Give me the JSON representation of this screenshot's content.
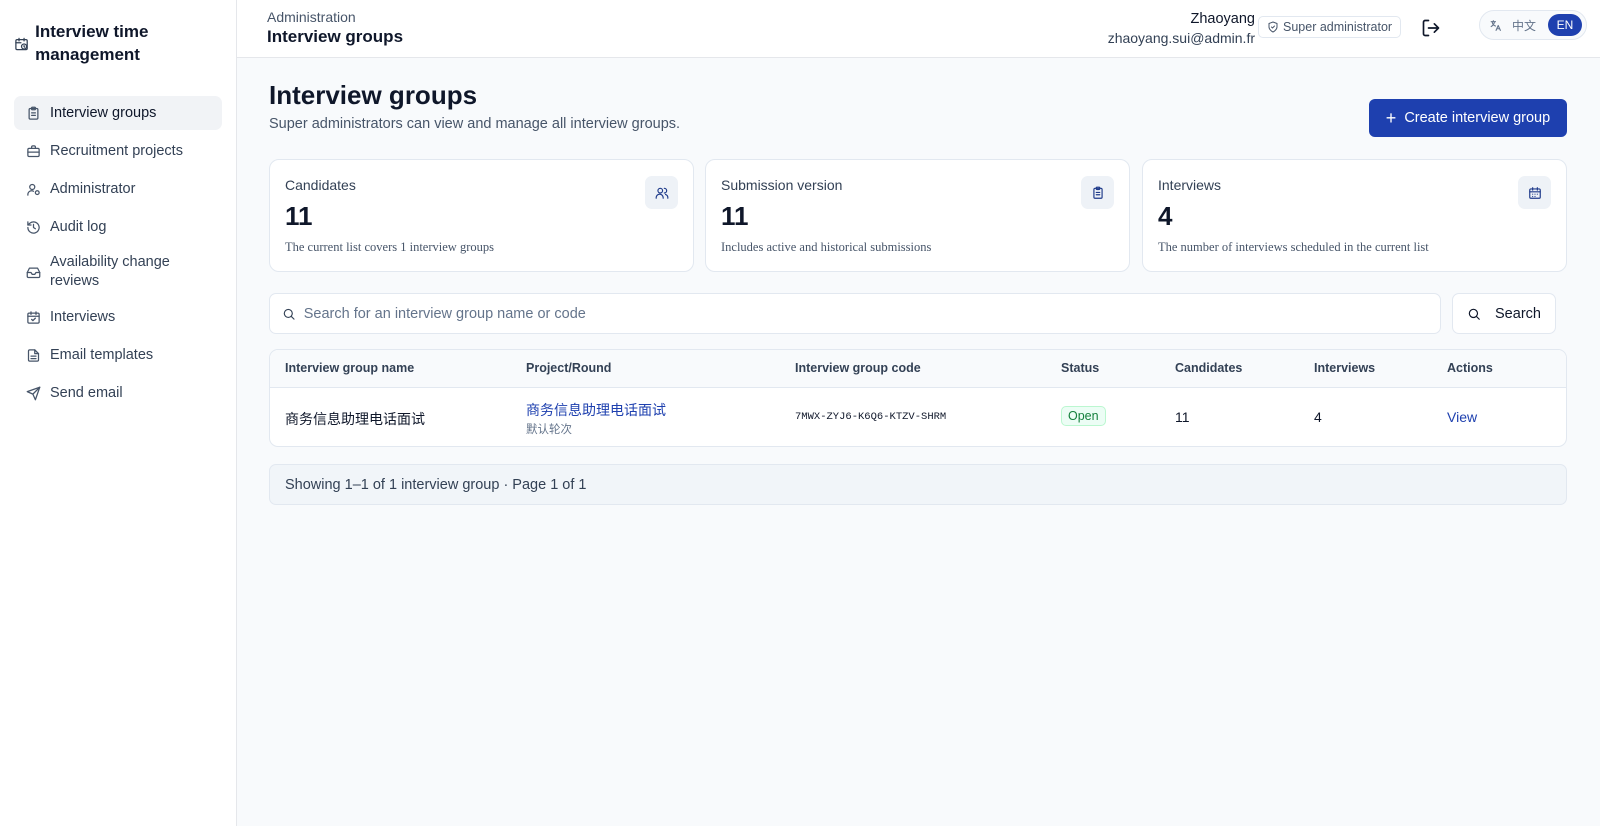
{
  "app": {
    "title": "Interview time management",
    "icon": "calendar-clock-icon"
  },
  "sidebar": {
    "items": [
      {
        "label": "Interview groups",
        "icon": "clipboard-icon",
        "active": true
      },
      {
        "label": "Recruitment projects",
        "icon": "briefcase-icon",
        "active": false
      },
      {
        "label": "Administrator",
        "icon": "user-cog-icon",
        "active": false
      },
      {
        "label": "Audit log",
        "icon": "history-icon",
        "active": false
      },
      {
        "label": "Availability change reviews",
        "icon": "inbox-icon",
        "active": false
      },
      {
        "label": "Interviews",
        "icon": "calendar-check-icon",
        "active": false
      },
      {
        "label": "Email templates",
        "icon": "document-icon",
        "active": false
      },
      {
        "label": "Send email",
        "icon": "send-icon",
        "active": false
      }
    ]
  },
  "header": {
    "breadcrumb": "Administration",
    "title": "Interview groups",
    "user_name": "Zhaoyang",
    "user_email": "zhaoyang.sui@admin.fr",
    "role": "Super administrator",
    "lang_zh": "中文",
    "lang_en": "EN",
    "accent_color": "#1e40af"
  },
  "page": {
    "title": "Interview groups",
    "subtitle": "Super administrators can view and manage all interview groups.",
    "create_button": "Create interview group"
  },
  "stats": [
    {
      "label": "Candidates",
      "value": "11",
      "desc": "The current list covers 1 interview groups",
      "icon": "users-icon"
    },
    {
      "label": "Submission version",
      "value": "11",
      "desc": "Includes active and historical submissions",
      "icon": "clipboard-icon"
    },
    {
      "label": "Interviews",
      "value": "4",
      "desc": "The number of interviews scheduled in the current list",
      "icon": "calendar-icon"
    }
  ],
  "search": {
    "placeholder": "Search for an interview group name or code",
    "value": "",
    "button": "Search"
  },
  "table": {
    "columns": [
      "Interview group name",
      "Project/Round",
      "Interview group code",
      "Status",
      "Candidates",
      "Interviews",
      "Actions"
    ],
    "rows": [
      {
        "name": "商务信息助理电话面试",
        "project": "商务信息助理电话面试",
        "round": "默认轮次",
        "code": "7MWX-ZYJ6-K6Q6-KTZV-SHRM",
        "status": "Open",
        "candidates": "11",
        "interviews": "4",
        "action": "View"
      }
    ]
  },
  "pagination": {
    "text": "Showing 1–1 of 1 interview group · Page 1 of 1"
  }
}
